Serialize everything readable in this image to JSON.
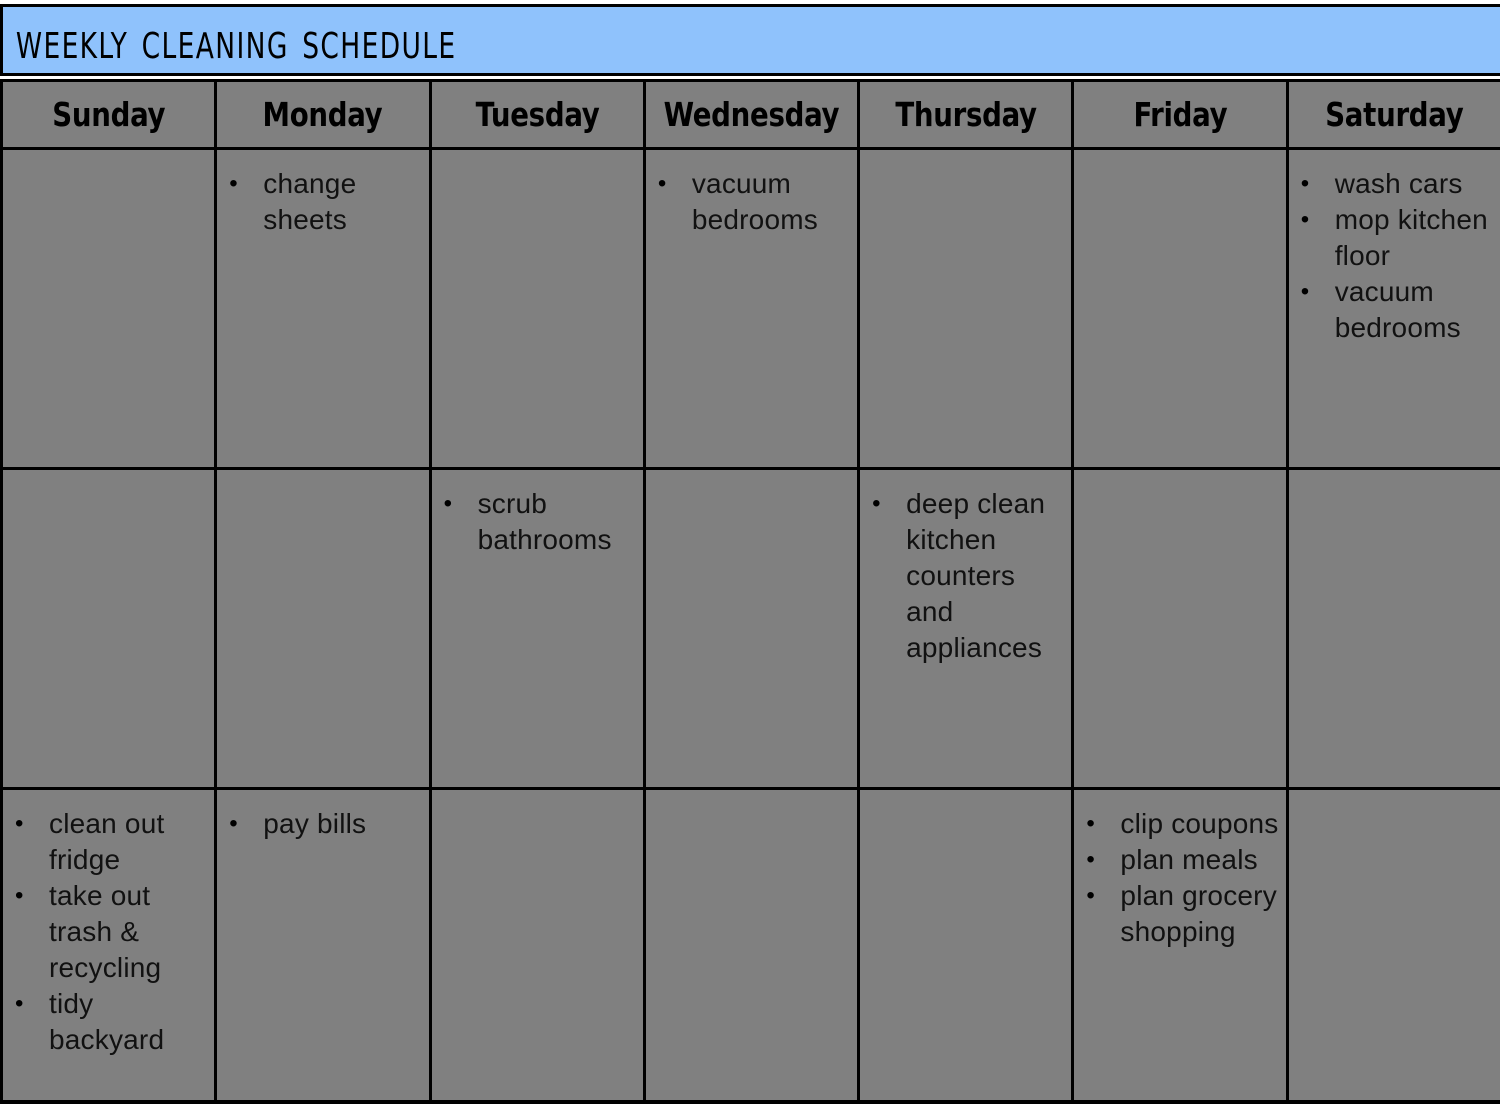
{
  "document": {
    "title": "weekly cleaning schedule",
    "title_bar_color": "#8fc2fc",
    "cell_background_color": "#808080",
    "grid_line_color": "#000000",
    "text_color": "#111111"
  },
  "columns": [
    {
      "id": "sunday",
      "label": "Sunday"
    },
    {
      "id": "monday",
      "label": "Monday"
    },
    {
      "id": "tuesday",
      "label": "Tuesday"
    },
    {
      "id": "wednesday",
      "label": "Wednesday"
    },
    {
      "id": "thursday",
      "label": "Thursday"
    },
    {
      "id": "friday",
      "label": "Friday"
    },
    {
      "id": "saturday",
      "label": "Saturday"
    }
  ],
  "rows": [
    {
      "row_index": 1,
      "cells": {
        "sunday": [],
        "monday": [
          "change sheets"
        ],
        "tuesday": [],
        "wednesday": [
          "vacuum bedrooms"
        ],
        "thursday": [],
        "friday": [],
        "saturday": [
          "wash cars",
          "mop kitchen floor",
          "vacuum bedrooms"
        ]
      }
    },
    {
      "row_index": 2,
      "cells": {
        "sunday": [],
        "monday": [],
        "tuesday": [
          "scrub bathrooms"
        ],
        "wednesday": [],
        "thursday": [
          "deep clean kitchen counters and appliances"
        ],
        "friday": [],
        "saturday": []
      }
    },
    {
      "row_index": 3,
      "cells": {
        "sunday": [
          "clean out fridge",
          "take out trash & recycling",
          "tidy backyard"
        ],
        "monday": [
          "pay bills"
        ],
        "tuesday": [],
        "wednesday": [],
        "thursday": [],
        "friday": [
          "clip coupons",
          "plan meals",
          "plan grocery shopping"
        ],
        "saturday": []
      }
    }
  ]
}
